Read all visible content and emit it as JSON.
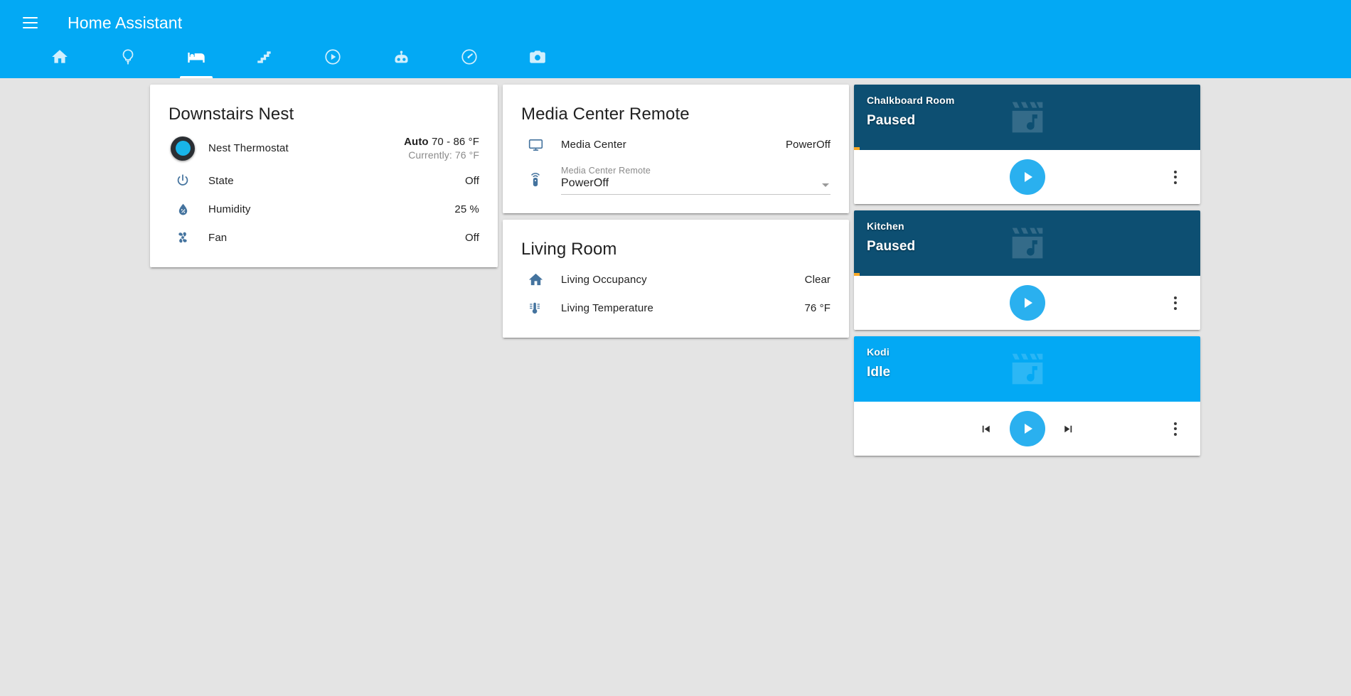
{
  "app": {
    "title": "Home Assistant",
    "menu_icon": "hamburger-menu-icon",
    "accent_color": "#03a9f4"
  },
  "tabs": [
    {
      "id": "home",
      "icon": "home-icon",
      "active": false
    },
    {
      "id": "lights",
      "icon": "lightbulb-icon",
      "active": false
    },
    {
      "id": "bedroom",
      "icon": "bed-icon",
      "active": true
    },
    {
      "id": "stairs",
      "icon": "stairs-icon",
      "active": false
    },
    {
      "id": "media",
      "icon": "play-circle-icon",
      "active": false
    },
    {
      "id": "robot",
      "icon": "robot-icon",
      "active": false
    },
    {
      "id": "gauge",
      "icon": "gauge-icon",
      "active": false
    },
    {
      "id": "camera",
      "icon": "camera-icon",
      "active": false
    }
  ],
  "cards": {
    "downstairs_nest": {
      "title": "Downstairs Nest",
      "rows": [
        {
          "icon": "nest-thermostat-dial-icon",
          "name": "Nest Thermostat",
          "value_bold": "Auto",
          "value": "70 - 86 °F",
          "value_sub": "Currently: 76 °F"
        },
        {
          "icon": "power-icon",
          "name": "State",
          "value": "Off"
        },
        {
          "icon": "humidity-icon",
          "name": "Humidity",
          "value": "25 %"
        },
        {
          "icon": "fan-icon",
          "name": "Fan",
          "value": "Off"
        }
      ]
    },
    "media_center_remote": {
      "title": "Media Center Remote",
      "rows": [
        {
          "icon": "television-icon",
          "name": "Media Center",
          "value": "PowerOff"
        }
      ],
      "select": {
        "icon": "remote-icon",
        "label": "Media Center Remote",
        "value": "PowerOff",
        "caret": "chevron-down-icon"
      }
    },
    "living_room": {
      "title": "Living Room",
      "rows": [
        {
          "icon": "home-icon",
          "name": "Living Occupancy",
          "value": "Clear"
        },
        {
          "icon": "thermometer-icon",
          "name": "Living Temperature",
          "value": "76 °F"
        }
      ]
    }
  },
  "media_players": [
    {
      "name": "Chalkboard Room",
      "state": "Paused",
      "theme": "dark",
      "header_color": "#0d4f72",
      "progress_color": "#f9a825",
      "progress_percent": 1.7,
      "art_icon": "music-movie-placeholder-icon",
      "controls": [
        "play-button",
        "more-vert-button"
      ]
    },
    {
      "name": "Kitchen",
      "state": "Paused",
      "theme": "dark",
      "header_color": "#0d4f72",
      "progress_color": "#f9a825",
      "progress_percent": 1.7,
      "art_icon": "music-movie-placeholder-icon",
      "controls": [
        "play-button",
        "more-vert-button"
      ]
    },
    {
      "name": "Kodi",
      "state": "Idle",
      "theme": "light",
      "header_color": "#03a9f4",
      "progress_color": "",
      "progress_percent": 0,
      "art_icon": "music-movie-placeholder-icon",
      "controls": [
        "previous-button",
        "play-button",
        "next-button",
        "more-vert-button"
      ]
    }
  ]
}
